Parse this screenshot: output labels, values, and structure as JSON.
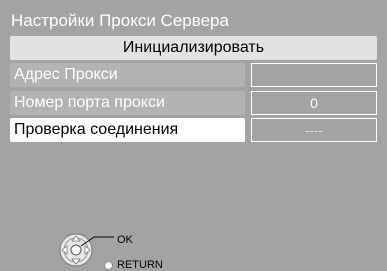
{
  "header": {
    "title": "Настройки Прокси Сервера"
  },
  "actions": {
    "initialize_label": "Инициализировать"
  },
  "settings": [
    {
      "label": "Адрес Прокси",
      "value": ""
    },
    {
      "label": "Номер порта прокси",
      "value": "0"
    },
    {
      "label": "Проверка соединения",
      "value": "----"
    }
  ],
  "legend": {
    "ok_label": "OK",
    "return_label": "RETURN"
  },
  "colors": {
    "background": "#a3a3a3",
    "selected": "#ffffff",
    "button": "#e2e2e2"
  }
}
